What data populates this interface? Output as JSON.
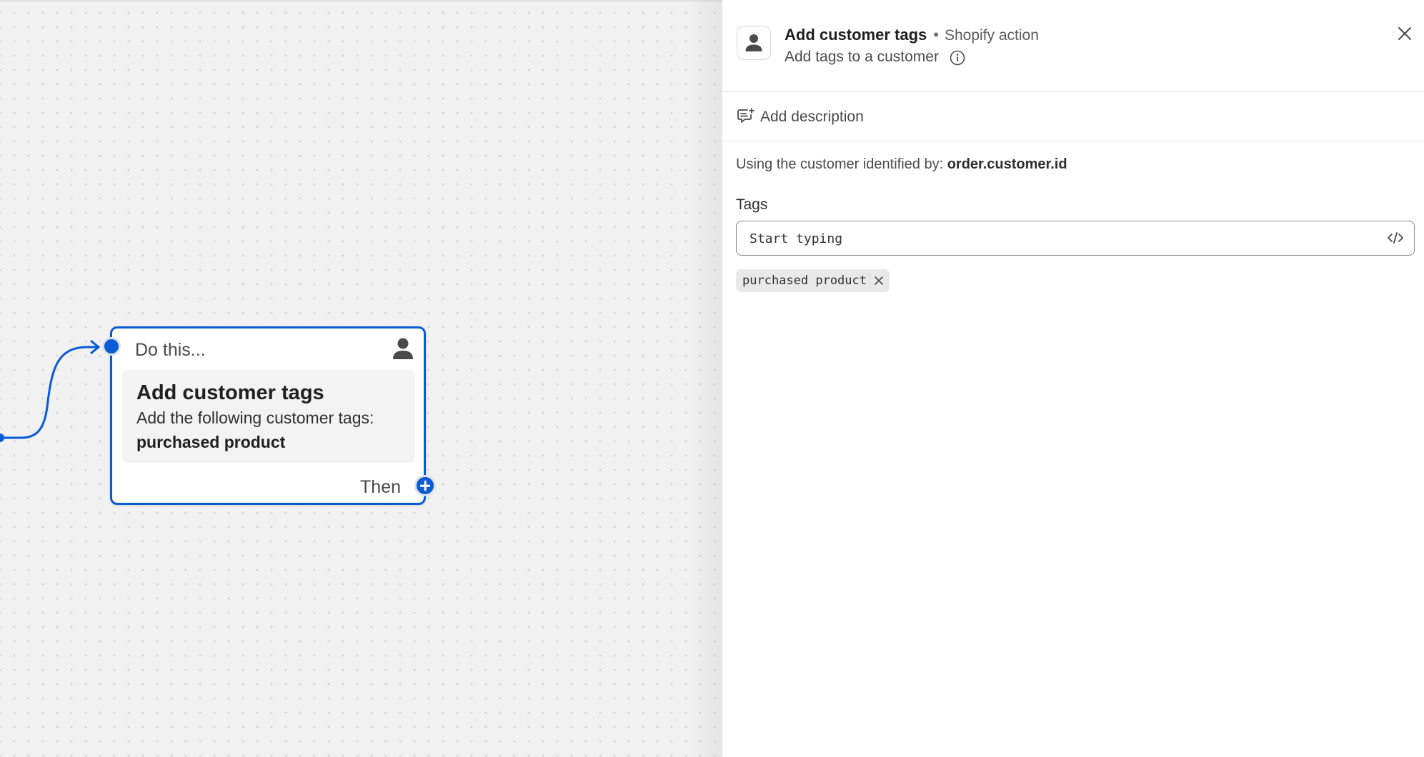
{
  "node": {
    "header": "Do this...",
    "title": "Add customer tags",
    "description": "Add the following customer tags:",
    "tag": "purchased product",
    "then_label": "Then"
  },
  "panel": {
    "title": "Add customer tags",
    "bullet": "•",
    "source": "Shopify action",
    "subtitle": "Add tags to a customer",
    "add_description": "Add description",
    "identified_prefix": "Using the customer identified by:",
    "identified_value": "order.customer.id",
    "tags_label": "Tags",
    "tags_placeholder": "Start typing",
    "chips": [
      "purchased product"
    ]
  },
  "icons": {
    "node_type": "person-icon",
    "panel_type": "person-icon",
    "info": "info-icon",
    "close": "close-icon",
    "description": "comment-edit-icon",
    "code": "code-icon",
    "chip_remove": "close-icon",
    "add": "plus-icon"
  },
  "colors": {
    "accent": "#0a5bd6",
    "canvas": "#f1f1f1",
    "panel": "#ffffff"
  }
}
